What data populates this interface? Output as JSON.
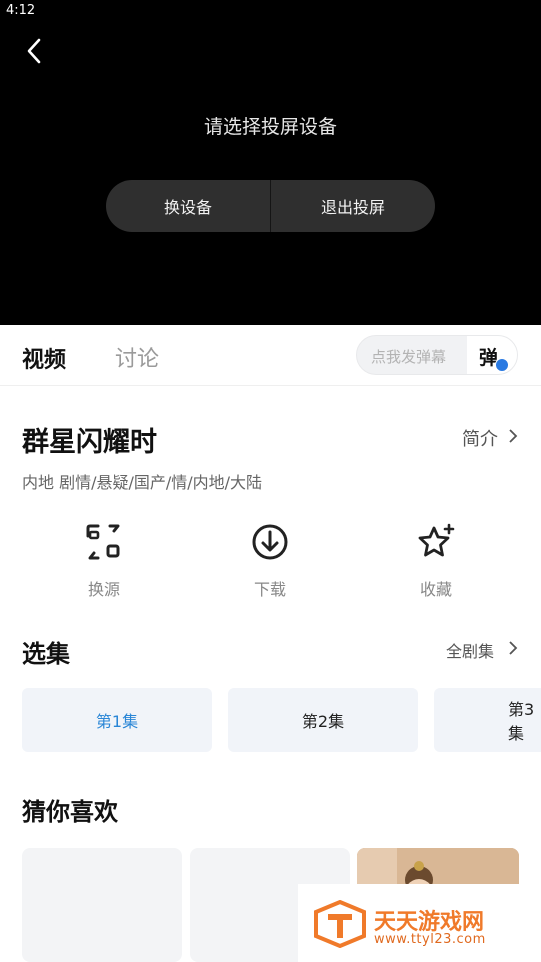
{
  "status_bar": {
    "time": "4:12"
  },
  "player": {
    "message": "请选择投屏设备",
    "change_device": "换设备",
    "exit_cast": "退出投屏"
  },
  "tabs": {
    "video": "视频",
    "discussion": "讨论"
  },
  "danmu": {
    "placeholder": "点我发弹幕",
    "toggle_char": "弹"
  },
  "show": {
    "title": "群星闪耀时",
    "intro": "简介",
    "meta": "内地  剧情/悬疑/国产/情/内地/大陆"
  },
  "actions": [
    {
      "label": "换源",
      "icon": "switch-source-icon"
    },
    {
      "label": "下载",
      "icon": "download-icon"
    },
    {
      "label": "收藏",
      "icon": "favorite-star-icon"
    }
  ],
  "episodes": {
    "title": "选集",
    "all_label": "全剧集",
    "items": [
      "第1集",
      "第2集",
      "第3集"
    ],
    "active_index": 0
  },
  "recommend": {
    "title": "猜你喜欢"
  },
  "watermark": {
    "name": "天天游戏网",
    "url": "www.ttyl23.com"
  },
  "colors": {
    "accent": "#2a86d6",
    "player_bg": "#000000",
    "watermark": "#f07a2a"
  }
}
